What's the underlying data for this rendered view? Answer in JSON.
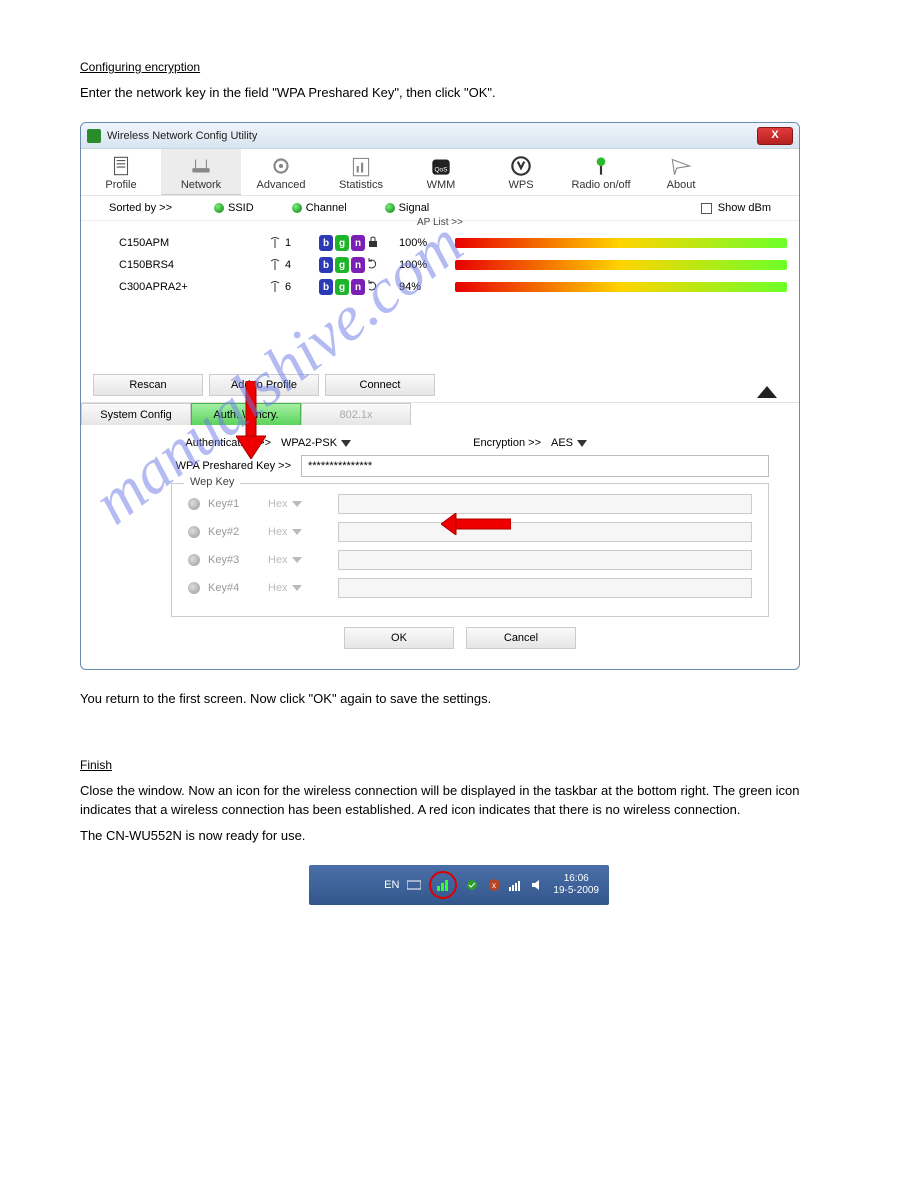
{
  "section1_title": "Configuring encryption",
  "section1_body1": "Enter the network key in the field \"WPA Preshared Key\", then click \"OK\".",
  "window": {
    "title": "Wireless Network Config Utility",
    "close": "X"
  },
  "toolbar": {
    "profile": "Profile",
    "network": "Network",
    "advanced": "Advanced",
    "statistics": "Statistics",
    "wmm": "WMM",
    "wps": "WPS",
    "radio": "Radio on/off",
    "about": "About"
  },
  "sortbar": {
    "label": "Sorted by >>",
    "ssid": "SSID",
    "channel": "Channel",
    "signal": "Signal",
    "showdbm": "Show dBm",
    "aplist": "AP List >>"
  },
  "ap": [
    {
      "ssid": "C150APM",
      "ch": "1",
      "pct": "100%"
    },
    {
      "ssid": "C150BRS4",
      "ch": "4",
      "pct": "100%"
    },
    {
      "ssid": "C300APRA2+",
      "ch": "6",
      "pct": "94%"
    }
  ],
  "badges": {
    "b": "b",
    "g": "g",
    "n": "n"
  },
  "btns": {
    "rescan": "Rescan",
    "addprof": "Add to Profile",
    "connect": "Connect"
  },
  "tabs": {
    "sysconf": "System Config",
    "authenc": "Auth. \\ Encry.",
    "dot1x": "802.1x"
  },
  "form": {
    "authlab": "Authentication >>",
    "authval": "WPA2-PSK",
    "enclab": "Encryption >>",
    "encval": "AES",
    "wpalab": "WPA Preshared Key >>",
    "wpavalue": "***************",
    "weplegend": "Wep Key",
    "keys": [
      "Key#1",
      "Key#2",
      "Key#3",
      "Key#4"
    ],
    "hex": "Hex",
    "ok": "OK",
    "cancel": "Cancel"
  },
  "section1_summary": "You return to the first screen. Now click \"OK\" again to save the settings.",
  "section2_title": "Finish",
  "section2_body1": "Close the window. Now an icon for the wireless connection will be displayed in the taskbar at the bottom right. The green icon indicates that a wireless connection has been established. A red icon indicates that there is no wireless connection.",
  "section2_body2": "The CN-WU552N is now ready for use.",
  "tray": {
    "lang": "EN",
    "time": "16:06",
    "date": "19-5-2009"
  },
  "watermark": "manualshive.com"
}
